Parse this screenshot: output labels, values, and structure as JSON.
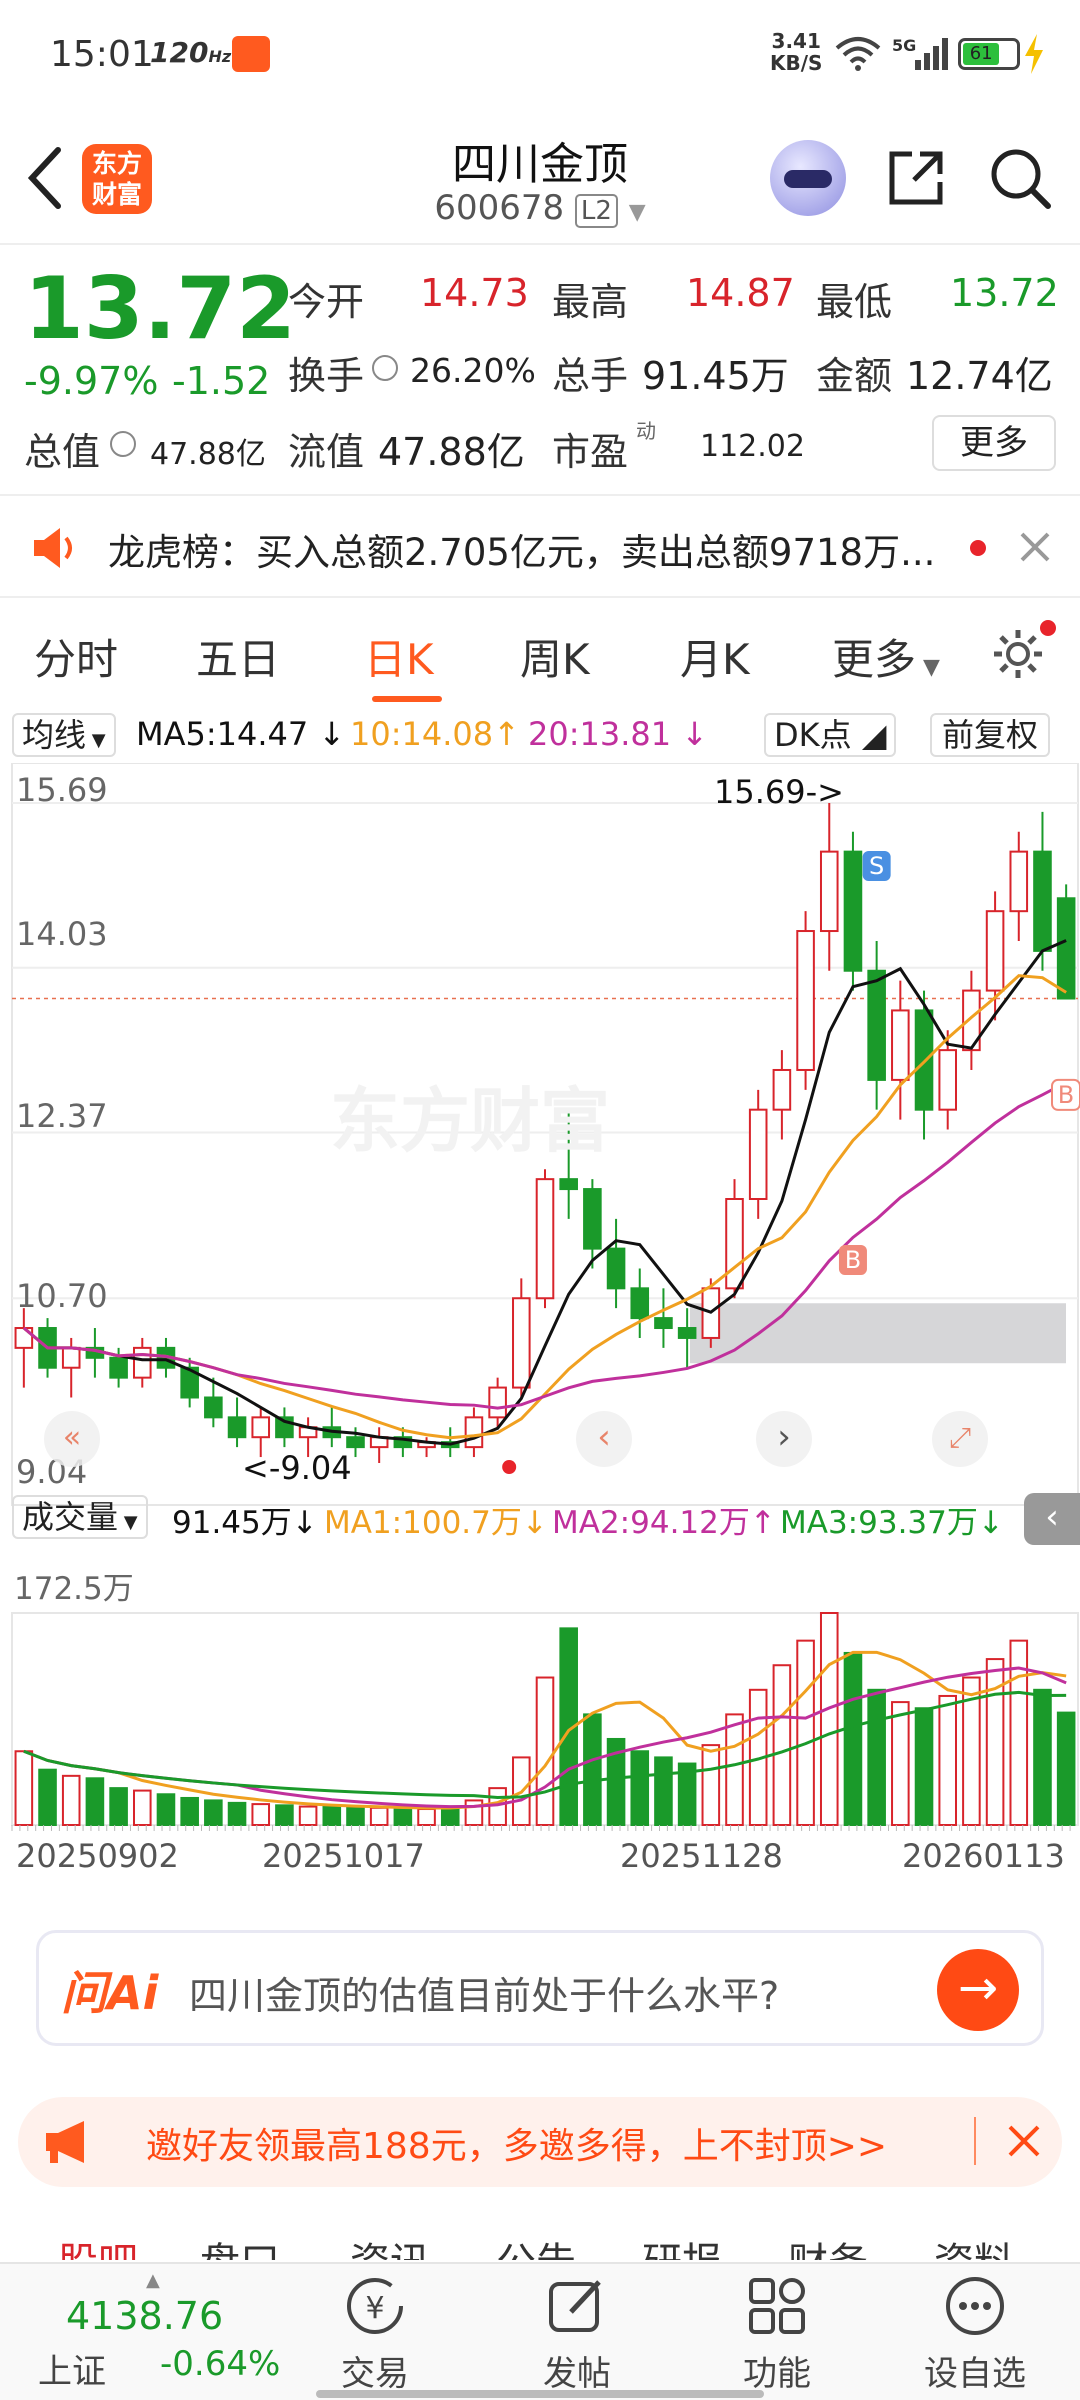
{
  "status": {
    "time": "15:01",
    "refresh": "120",
    "refresh_unit": "Hz",
    "net_speed": "3.41",
    "net_unit": "KB/S",
    "signal": "5G",
    "battery": "61"
  },
  "header": {
    "logo_line1": "东方",
    "logo_line2": "财富",
    "title": "四川金顶",
    "code": "600678",
    "level": "L2"
  },
  "quote": {
    "price": "13.72",
    "change_pct": "-9.97%",
    "change": "-1.52",
    "open_label": "今开",
    "open": "14.73",
    "high_label": "最高",
    "high": "14.87",
    "low_label": "最低",
    "low": "13.72",
    "turnover_label": "换手",
    "turnover": "26.20%",
    "volume_label": "总手",
    "volume": "91.45万",
    "amount_label": "金额",
    "amount": "12.74亿",
    "mcap_label": "总值",
    "mcap": "47.88亿",
    "float_label": "流值",
    "float_cap": "47.88亿",
    "pe_label": "市盈",
    "pe_sup": "动",
    "pe": "112.02",
    "more_label": "更多"
  },
  "notice": {
    "text": "龙虎榜：买入总额2.705亿元，卖出总额9718万..."
  },
  "tabs": [
    "分时",
    "五日",
    "日K",
    "周K",
    "月K",
    "更多"
  ],
  "active_tab": "日K",
  "kline": {
    "ma_selector": "均线",
    "ma5": "MA5:14.47",
    "ma10": "10:14.08",
    "ma20": "20:13.81",
    "dk_label": "DK点",
    "fq_label": "前复权",
    "ticks": [
      "15.69",
      "14.03",
      "12.37",
      "10.70",
      "9.04"
    ],
    "high_marker": "15.69->",
    "low_marker": "<-9.04",
    "watermark": "东方财富",
    "s_marker": "S",
    "b_marker": "B"
  },
  "volume": {
    "selector": "成交量",
    "vol": "91.45万",
    "ma1": "MA1:100.7万",
    "ma2": "MA2:94.12万",
    "ma3": "MA3:93.37万",
    "max_tick": "172.5万"
  },
  "dates": [
    "20250902",
    "20251017",
    "20251128",
    "20260113"
  ],
  "colors": {
    "up": "#d8242b",
    "down": "#1a9a2a",
    "ma5": "#111111",
    "ma10": "#f0a020",
    "ma20": "#c0309c",
    "accent": "#ff5a1f"
  },
  "chart_data": {
    "type": "candlestick",
    "ylim": [
      9.04,
      15.69
    ],
    "ohlc": [
      [
        10.2,
        10.6,
        9.8,
        10.4
      ],
      [
        10.4,
        10.5,
        9.9,
        10.0
      ],
      [
        10.0,
        10.3,
        9.7,
        10.2
      ],
      [
        10.2,
        10.4,
        9.9,
        10.1
      ],
      [
        10.1,
        10.2,
        9.8,
        9.9
      ],
      [
        9.9,
        10.3,
        9.8,
        10.2
      ],
      [
        10.2,
        10.3,
        9.9,
        10.0
      ],
      [
        10.0,
        10.1,
        9.6,
        9.7
      ],
      [
        9.7,
        9.9,
        9.4,
        9.5
      ],
      [
        9.5,
        9.7,
        9.2,
        9.3
      ],
      [
        9.3,
        9.6,
        9.1,
        9.5
      ],
      [
        9.5,
        9.6,
        9.2,
        9.3
      ],
      [
        9.3,
        9.5,
        9.1,
        9.4
      ],
      [
        9.4,
        9.6,
        9.2,
        9.3
      ],
      [
        9.3,
        9.4,
        9.1,
        9.2
      ],
      [
        9.2,
        9.4,
        9.04,
        9.3
      ],
      [
        9.3,
        9.4,
        9.1,
        9.2
      ],
      [
        9.2,
        9.3,
        9.1,
        9.25
      ],
      [
        9.25,
        9.4,
        9.1,
        9.2
      ],
      [
        9.2,
        9.6,
        9.1,
        9.5
      ],
      [
        9.5,
        9.9,
        9.4,
        9.8
      ],
      [
        9.8,
        10.9,
        9.7,
        10.7
      ],
      [
        10.7,
        12.0,
        10.6,
        11.9
      ],
      [
        11.9,
        12.6,
        11.5,
        11.8
      ],
      [
        11.8,
        11.9,
        11.0,
        11.2
      ],
      [
        11.2,
        11.5,
        10.6,
        10.8
      ],
      [
        10.8,
        11.0,
        10.3,
        10.5
      ],
      [
        10.5,
        10.8,
        10.2,
        10.4
      ],
      [
        10.4,
        10.6,
        10.0,
        10.3
      ],
      [
        10.3,
        10.9,
        10.2,
        10.8
      ],
      [
        10.8,
        11.9,
        10.7,
        11.7
      ],
      [
        11.7,
        12.8,
        11.5,
        12.6
      ],
      [
        12.6,
        13.2,
        12.3,
        13.0
      ],
      [
        13.0,
        14.6,
        12.8,
        14.4
      ],
      [
        14.4,
        15.69,
        14.0,
        15.2
      ],
      [
        15.2,
        15.4,
        13.8,
        14.0
      ],
      [
        14.0,
        14.3,
        12.6,
        12.9
      ],
      [
        12.9,
        13.9,
        12.5,
        13.6
      ],
      [
        13.6,
        13.8,
        12.3,
        12.6
      ],
      [
        12.6,
        13.4,
        12.4,
        13.2
      ],
      [
        13.2,
        14.0,
        13.0,
        13.8
      ],
      [
        13.8,
        14.8,
        13.5,
        14.6
      ],
      [
        14.6,
        15.4,
        14.3,
        15.2
      ],
      [
        15.2,
        15.6,
        14.0,
        14.2
      ],
      [
        14.73,
        14.87,
        13.72,
        13.72
      ]
    ],
    "volume": [
      60,
      45,
      40,
      38,
      30,
      28,
      25,
      22,
      20,
      18,
      17,
      16,
      15,
      15,
      14,
      14,
      13,
      13,
      15,
      20,
      30,
      55,
      120,
      160,
      90,
      70,
      60,
      55,
      50,
      65,
      90,
      110,
      130,
      150,
      172.5,
      140,
      110,
      100,
      95,
      105,
      120,
      135,
      150,
      110,
      91.45
    ]
  }
}
